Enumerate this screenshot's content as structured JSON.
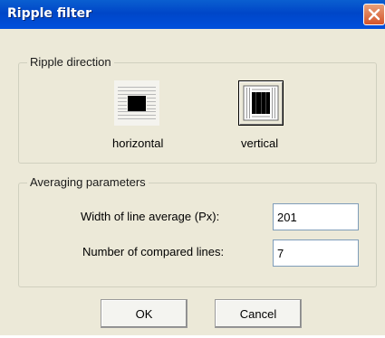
{
  "window": {
    "title": "Ripple filter"
  },
  "ripple_group": {
    "legend": "Ripple direction",
    "horizontal_label": "horizontal",
    "vertical_label": "vertical",
    "selected": "vertical"
  },
  "averaging_group": {
    "legend": "Averaging parameters",
    "width_label": "Width of line average (Px):",
    "width_value": "201",
    "lines_label": "Number of compared lines:",
    "lines_value": "7"
  },
  "buttons": {
    "ok": "OK",
    "cancel": "Cancel"
  },
  "icons": {
    "close": "close-icon",
    "horizontal": "horizontal-ripple-icon",
    "vertical": "vertical-ripple-icon"
  },
  "colors": {
    "titlebar": "#0050dc",
    "close": "#d4542a",
    "dialog": "#ece9d8"
  }
}
